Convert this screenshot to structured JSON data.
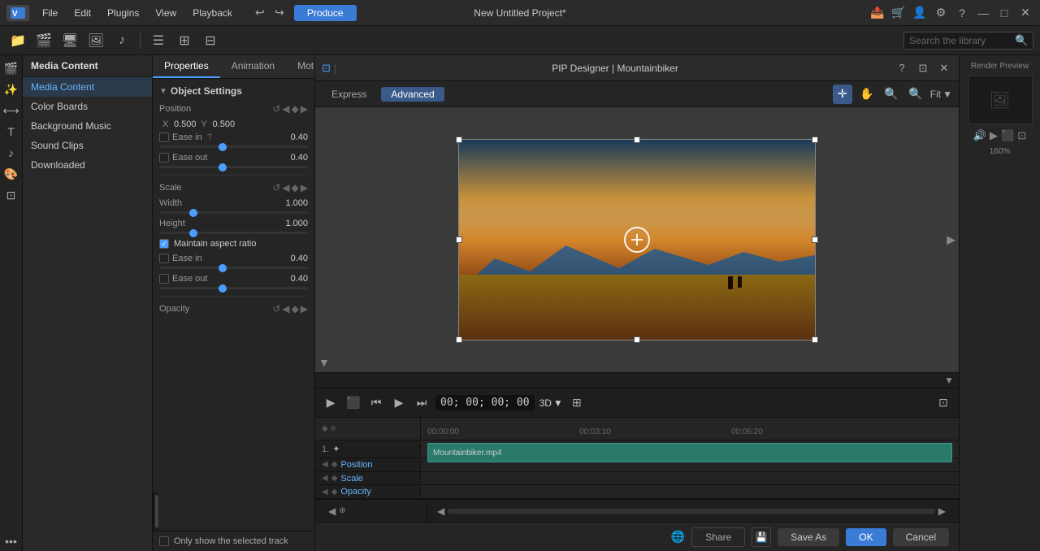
{
  "app": {
    "title": "New Untitled Project*",
    "produce_label": "Produce"
  },
  "menu": {
    "items": [
      "File",
      "Edit",
      "Plugins",
      "View",
      "Playback"
    ]
  },
  "toolbar": {
    "search_placeholder": "Search the library"
  },
  "left_panel": {
    "title": "Media Content",
    "items": [
      {
        "label": "Media Content",
        "active": true
      },
      {
        "label": "Color Boards"
      },
      {
        "label": "Background Music"
      },
      {
        "label": "Sound Clips"
      },
      {
        "label": "Downloaded"
      }
    ]
  },
  "properties": {
    "tabs": [
      "Properties",
      "Animation",
      "Motion"
    ],
    "active_tab": "Properties",
    "section_title": "Object Settings",
    "position": {
      "label": "Position",
      "x_label": "X",
      "x_value": "0.500",
      "y_label": "Y",
      "y_value": "0.500"
    },
    "ease_in_1": {
      "label": "Ease in",
      "checked": false,
      "value": "0.40"
    },
    "ease_out_1": {
      "label": "Ease out",
      "checked": false,
      "value": "0.40"
    },
    "scale": {
      "label": "Scale"
    },
    "width": {
      "label": "Width",
      "value": "1.000"
    },
    "height": {
      "label": "Height",
      "value": "1.000"
    },
    "maintain_aspect": {
      "label": "Maintain aspect ratio",
      "checked": true
    },
    "ease_in_2": {
      "label": "Ease in",
      "checked": false,
      "value": "0.40"
    },
    "ease_out_2": {
      "label": "Ease out",
      "checked": false,
      "value": "0.40"
    },
    "opacity": {
      "label": "Opacity"
    },
    "only_show": {
      "label": "Only show the selected track",
      "checked": false
    }
  },
  "pip": {
    "title": "PIP Designer | Mountainbiker",
    "tabs": [
      "Express",
      "Advanced"
    ],
    "active_tab": "Advanced",
    "fit_label": "Fit"
  },
  "timeline": {
    "timecode": "00; 00; 00; 00",
    "mode": "3D",
    "marks": [
      "00:00:00",
      "00:03:10",
      "00:06:20"
    ],
    "tracks": [
      {
        "num": "1.",
        "icon": "✦",
        "clip_label": "Mountainbiker.mp4"
      }
    ],
    "prop_tracks": [
      {
        "label": "Position"
      },
      {
        "label": "Scale"
      },
      {
        "label": "Opacity"
      }
    ]
  },
  "bottom_buttons": {
    "share_label": "Share",
    "save_as_label": "Save As",
    "ok_label": "OK",
    "cancel_label": "Cancel"
  },
  "render_panel": {
    "label": "Render Preview",
    "zoom": "160%"
  }
}
